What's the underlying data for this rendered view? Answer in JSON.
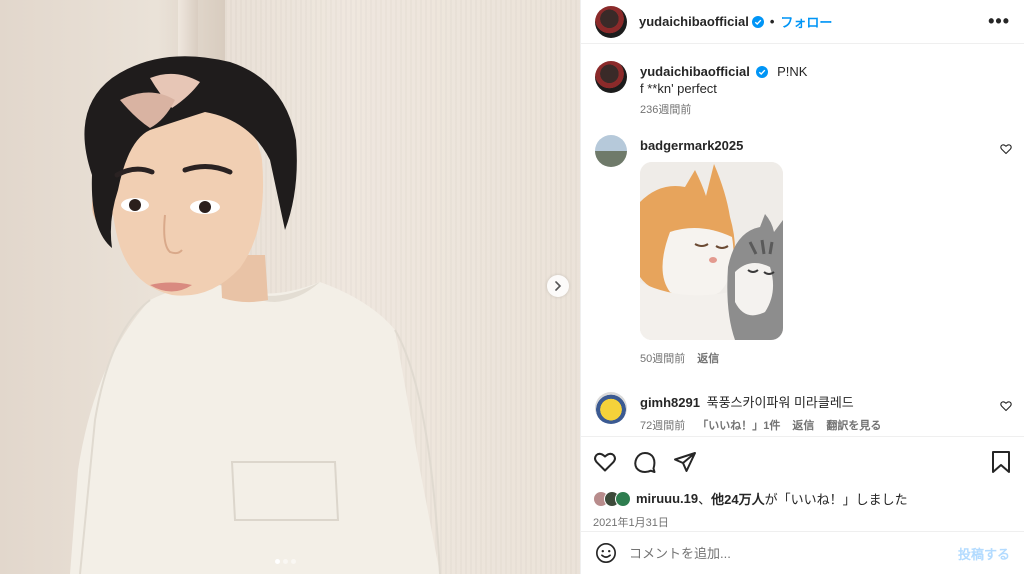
{
  "header": {
    "username": "yudaichibaofficial",
    "bullet": "•",
    "follow_label": "フォロー",
    "more_label": "•••"
  },
  "caption": {
    "username": "yudaichibaofficial",
    "title": "P!NK",
    "text": "f **kn' perfect",
    "time": "236週間前"
  },
  "comments": [
    {
      "username": "badgermark2025",
      "text": "",
      "has_gif": true,
      "time": "50週間前",
      "reply_label": "返信"
    },
    {
      "username": "gimh8291",
      "text": "푹풍스카이파워 미라클레드",
      "time": "72週間前",
      "likes_label": "「いいね！」1件",
      "reply_label": "返信",
      "translate_label": "翻訳を見る"
    }
  ],
  "likes": {
    "lead_user": "miruuu.19",
    "separator": "、",
    "others": "他24万人",
    "suffix": "が「いいね！」しました"
  },
  "post_date": "2021年1月31日",
  "composer": {
    "placeholder": "コメントを追加...",
    "post_label": "投稿する"
  },
  "colors": {
    "accent": "#0095f6",
    "verified": "#0095f6",
    "muted_text": "#737373",
    "post_disabled": "#b3dbff"
  },
  "carousel": {
    "slides": 3,
    "active_slide": 1
  }
}
